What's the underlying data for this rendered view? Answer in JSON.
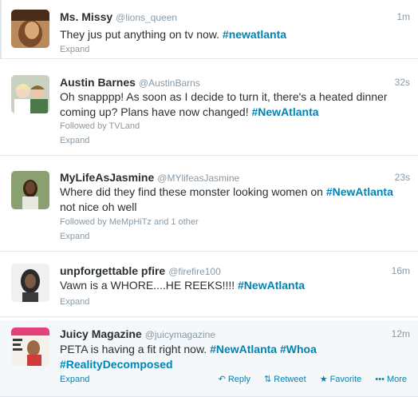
{
  "tweets": [
    {
      "fullname": "Ms. Missy",
      "username": "@lions_queen",
      "time": "1m",
      "text_parts": [
        "They jus put anything on tv now. ",
        "#newatlanta"
      ],
      "expand": "Expand"
    },
    {
      "fullname": "Austin Barnes",
      "username": "@AustinBarns",
      "time": "32s",
      "text_line1": "Oh snapppp! As soon as I decide to turn it, there's a heated dinner",
      "text_line2a": "coming up? Plans have now changed! ",
      "text_line2b": "#NewAtlanta",
      "followed_by": "Followed by TVLand",
      "expand": "Expand"
    },
    {
      "fullname": "MyLifeAsJasmine",
      "username": "@MYlifeasJasmine",
      "time": "23s",
      "text_line1a": "Where did they find these monster looking women on ",
      "text_line1b": "#NewAtlanta",
      "text_line2": "not nice oh well",
      "followed_by": "Followed by MeMpHiTz and 1 other",
      "expand": "Expand"
    },
    {
      "fullname": "unpforgettable pfire",
      "username": "@firefire100",
      "time": "16m",
      "text_a": "Vawn is a WHORE....HE REEKS!!!! ",
      "text_b": "#NewAtlanta",
      "expand": "Expand"
    },
    {
      "fullname": "Juicy Magazine",
      "username": "@juicymagazine",
      "time": "12m",
      "text_a": "PETA is having a fit right now. ",
      "text_b": "#NewAtlanta",
      "text_c": " ",
      "text_d": "#Whoa",
      "text_e": "#RealityDecomposed",
      "expand": "Expand",
      "actions": {
        "reply": "Reply",
        "retweet": "Retweet",
        "favorite": "Favorite",
        "more": "More"
      }
    }
  ],
  "colors": {
    "link": "#0084b4",
    "muted": "#8899a6",
    "text": "#292f33",
    "hover_bg": "#f5f8fa"
  },
  "icons": {
    "reply": "reply-icon",
    "retweet": "retweet-icon",
    "favorite": "star-icon",
    "more": "more-icon"
  }
}
